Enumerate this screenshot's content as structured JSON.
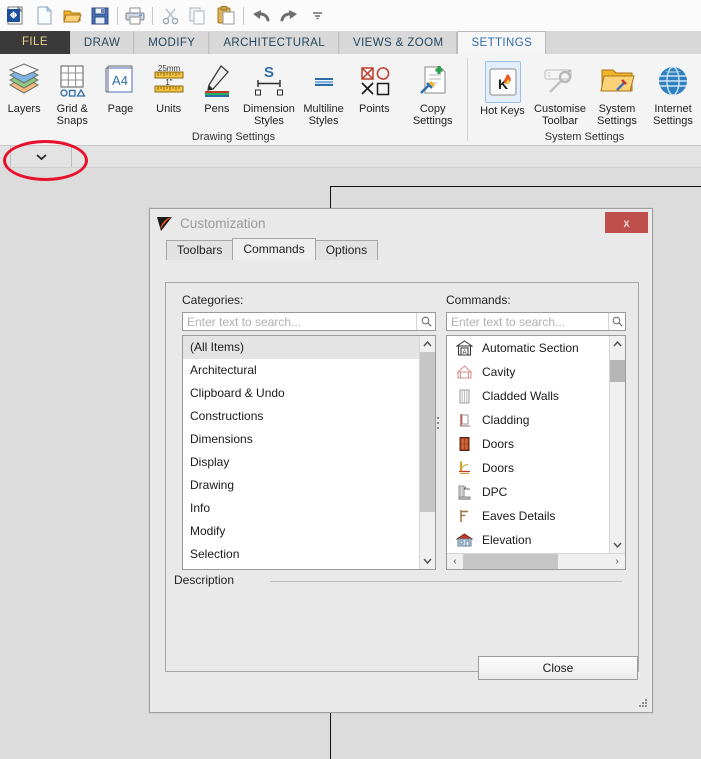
{
  "quick_access": {
    "items": [
      {
        "name": "app-logo-icon",
        "label": "App"
      },
      {
        "name": "new-file-icon",
        "label": "New"
      },
      {
        "name": "open-folder-icon",
        "label": "Open"
      },
      {
        "name": "save-icon",
        "label": "Save"
      },
      {
        "name": "print-icon",
        "label": "Print"
      },
      {
        "name": "cut-icon",
        "label": "Cut"
      },
      {
        "name": "copy-icon",
        "label": "Copy"
      },
      {
        "name": "paste-icon",
        "label": "Paste"
      },
      {
        "name": "undo-icon",
        "label": "Undo"
      },
      {
        "name": "redo-icon",
        "label": "Redo"
      },
      {
        "name": "qat-dropdown-icon",
        "label": "Customize Quick Access Toolbar"
      }
    ]
  },
  "ribbon": {
    "tabs": [
      {
        "label": "FILE",
        "active": false,
        "file": true
      },
      {
        "label": "DRAW",
        "active": false
      },
      {
        "label": "MODIFY",
        "active": false
      },
      {
        "label": "ARCHITECTURAL",
        "active": false
      },
      {
        "label": "VIEWS & ZOOM",
        "active": false
      },
      {
        "label": "SETTINGS",
        "active": true
      }
    ],
    "groups": [
      {
        "label": "Drawing Settings",
        "buttons": [
          {
            "label": "Layers",
            "icon": "layers-icon",
            "selected": false
          },
          {
            "label": "Grid &\nSnaps",
            "icon": "grid-snaps-icon",
            "selected": false
          },
          {
            "label": "Page",
            "icon": "page-icon",
            "selected": false
          },
          {
            "label": "Units",
            "icon": "units-icon",
            "selected": false
          },
          {
            "label": "Pens",
            "icon": "pens-icon",
            "selected": false
          },
          {
            "label": "Dimension\nStyles",
            "icon": "dimension-styles-icon",
            "selected": false
          },
          {
            "label": "Multiline\nStyles",
            "icon": "multiline-styles-icon",
            "selected": false
          },
          {
            "label": "Points",
            "icon": "points-icon",
            "selected": false
          },
          {
            "label": "Copy Settings",
            "icon": "copy-settings-icon",
            "selected": false
          }
        ]
      },
      {
        "label": "System Settings",
        "buttons": [
          {
            "label": "Hot Keys",
            "icon": "hot-keys-icon",
            "selected": true
          },
          {
            "label": "Customise\nToolbar",
            "icon": "customise-toolbar-icon",
            "selected": false
          },
          {
            "label": "System\nSettings",
            "icon": "system-settings-icon",
            "selected": false
          },
          {
            "label": "Internet\nSettings",
            "icon": "internet-settings-icon",
            "selected": false
          }
        ]
      }
    ],
    "collapse_button": {
      "icon": "chevron-down-icon",
      "label": ""
    }
  },
  "annotation": {
    "shape": "ellipse",
    "color": "#e8112d"
  },
  "dialog": {
    "title": "Customization",
    "close_x": "x",
    "tabs": [
      {
        "label": "Toolbars",
        "active": false
      },
      {
        "label": "Commands",
        "active": true
      },
      {
        "label": "Options",
        "active": false
      }
    ],
    "categories": {
      "label": "Categories:",
      "search_value": "",
      "search_placeholder": "Enter text to search...",
      "items": [
        {
          "label": "(All Items)",
          "selected": true
        },
        {
          "label": "Architectural",
          "selected": false
        },
        {
          "label": "Clipboard & Undo",
          "selected": false
        },
        {
          "label": "Constructions",
          "selected": false
        },
        {
          "label": "Dimensions",
          "selected": false
        },
        {
          "label": "Display",
          "selected": false
        },
        {
          "label": "Drawing",
          "selected": false
        },
        {
          "label": "Info",
          "selected": false
        },
        {
          "label": "Modify",
          "selected": false
        },
        {
          "label": "Selection",
          "selected": false
        }
      ]
    },
    "commands": {
      "label": "Commands:",
      "search_value": "",
      "search_placeholder": "Enter text to search...",
      "items": [
        {
          "label": "Automatic Section",
          "icon": "automatic-section-icon"
        },
        {
          "label": "Cavity",
          "icon": "cavity-icon"
        },
        {
          "label": "Cladded Walls",
          "icon": "cladded-walls-icon"
        },
        {
          "label": "Cladding",
          "icon": "cladding-icon"
        },
        {
          "label": "Doors",
          "icon": "doors-elevation-icon"
        },
        {
          "label": "Doors",
          "icon": "doors-plan-icon"
        },
        {
          "label": "DPC",
          "icon": "dpc-icon"
        },
        {
          "label": "Eaves Details",
          "icon": "eaves-details-icon"
        },
        {
          "label": "Elevation",
          "icon": "elevation-icon"
        }
      ]
    },
    "description": {
      "label": "Description",
      "text": ""
    },
    "close_button": "Close"
  },
  "colors": {
    "accent_red": "#e8112d",
    "close_button_red": "#c0504d",
    "tab_active_text": "#2f6da8",
    "file_tab_bg": "#3a3a3a",
    "file_tab_text": "#e8d48a"
  }
}
